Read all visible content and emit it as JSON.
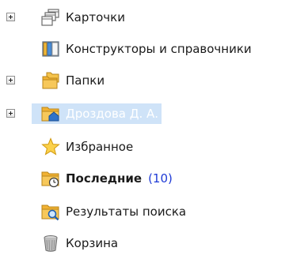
{
  "tree": {
    "items": [
      {
        "label": "Карточки",
        "icon": "cards-icon",
        "expandable": true
      },
      {
        "label": "Конструкторы и справочники",
        "icon": "book-icon",
        "expandable": false
      },
      {
        "label": "Папки",
        "icon": "folders-icon",
        "expandable": true
      },
      {
        "label": "Дроздова Д. А.",
        "icon": "user-folder-icon",
        "expandable": true,
        "selected": true
      },
      {
        "label": "Избранное",
        "icon": "star-icon",
        "expandable": false
      },
      {
        "label": "Последние",
        "count": "(10)",
        "icon": "recent-folder-icon",
        "expandable": false
      },
      {
        "label": "Результаты поиска",
        "icon": "search-folder-icon",
        "expandable": false
      },
      {
        "label": "Корзина",
        "icon": "trash-icon",
        "expandable": false
      }
    ]
  },
  "colors": {
    "selection_bg": "#cfe3f8",
    "count_color": "#1f3bd6",
    "folder_color": "#f2b233"
  }
}
